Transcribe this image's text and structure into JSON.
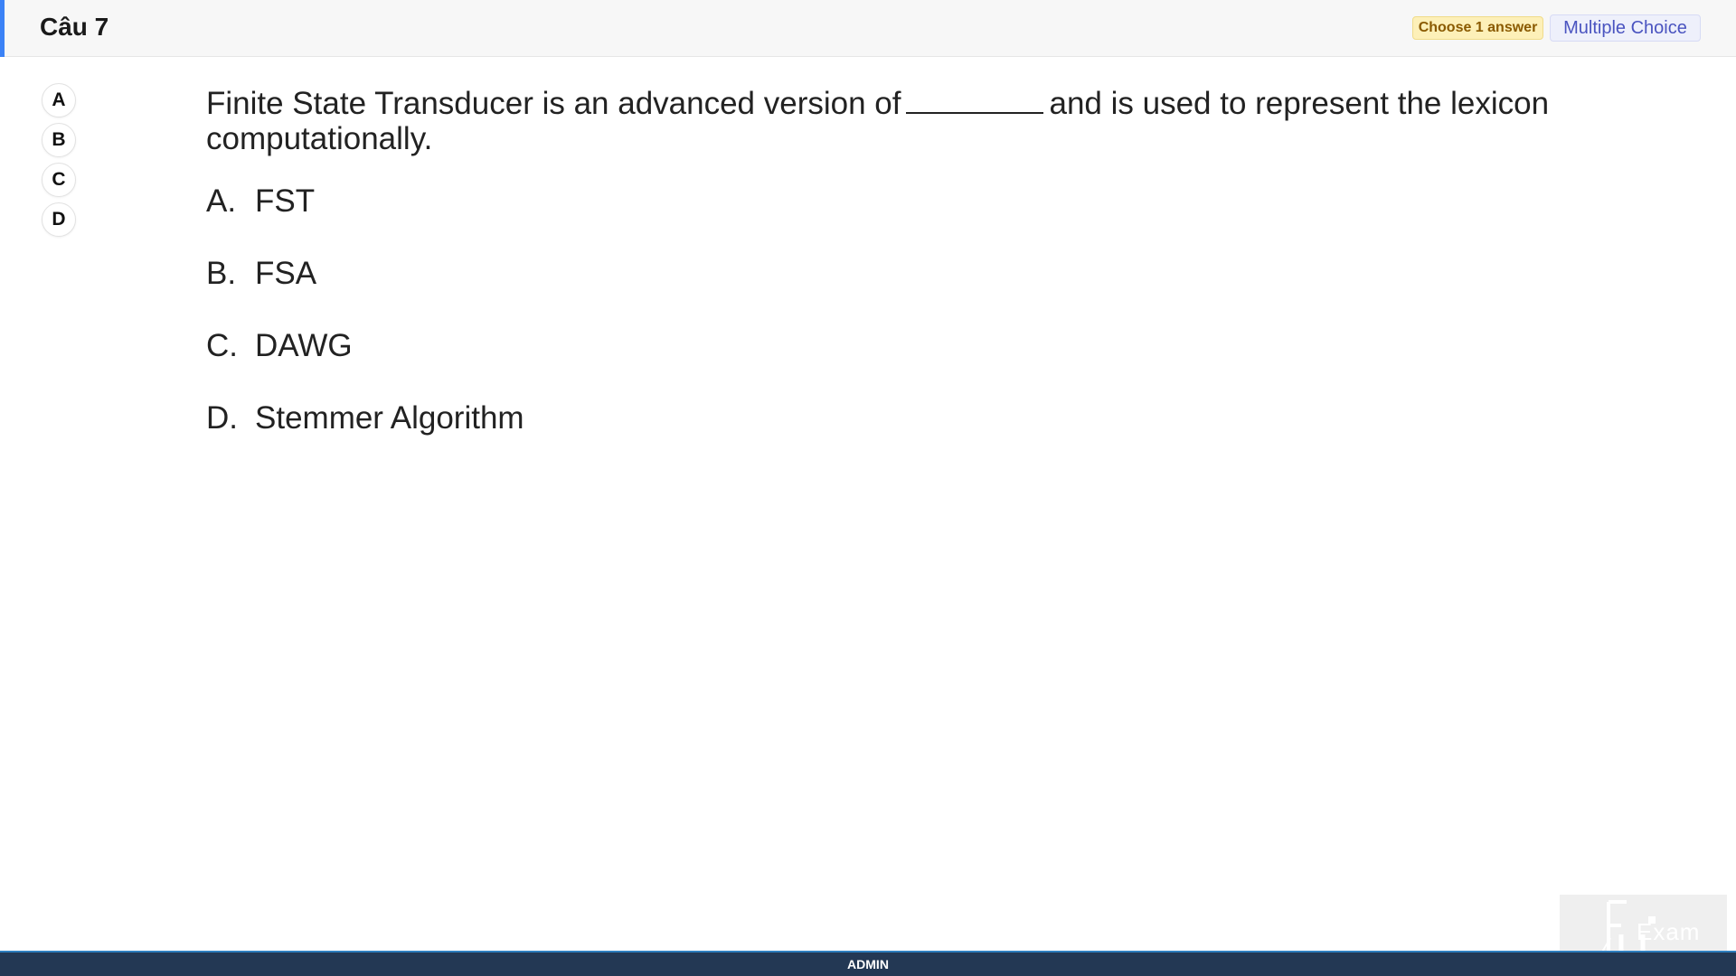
{
  "header": {
    "title": "Câu 7",
    "choose_badge": "Choose 1 answer",
    "type_badge": "Multiple Choice",
    "accent_color": "#3b82f6"
  },
  "choices": [
    "A",
    "B",
    "C",
    "D"
  ],
  "question": {
    "text_before": "Finite State Transducer is an advanced version of",
    "text_after": "and is used to represent the lexicon computationally.",
    "options": [
      {
        "letter": "A.",
        "text": "FST"
      },
      {
        "letter": "B.",
        "text": "FSA"
      },
      {
        "letter": "C.",
        "text": "DAWG"
      },
      {
        "letter": "D.",
        "text": "Stemmer Algorithm"
      }
    ]
  },
  "footer": {
    "label": "ADMIN"
  },
  "watermark": {
    "text": "Exam"
  }
}
